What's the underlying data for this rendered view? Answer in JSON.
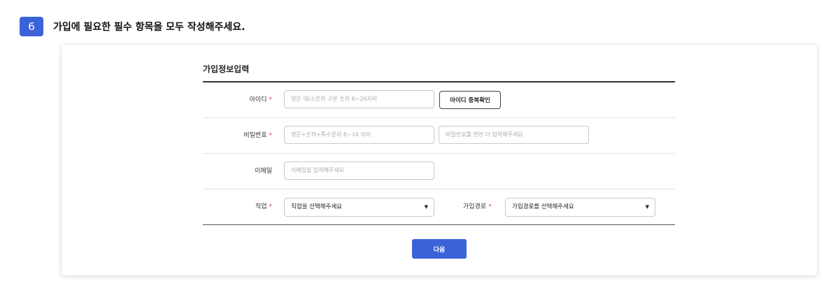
{
  "step": {
    "number": "6",
    "instruction": "가입에 필요한 필수 항목을 모두 작성해주세요."
  },
  "form": {
    "title": "가입정보입력",
    "required_mark": "*",
    "id": {
      "label": "아이디",
      "placeholder": "영문 대/소문자 구분 숫자 6~20자리",
      "check_button": "아이디 중복확인"
    },
    "password": {
      "label": "비밀번호",
      "placeholder": "영문+숫자+특수문자 8~16 자리",
      "confirm_placeholder": "비밀번호를 한번 더 입력해주세요"
    },
    "email": {
      "label": "이메일",
      "placeholder": "이메일을 입력해주세요"
    },
    "job": {
      "label": "직업",
      "selected": "직업을 선택해주세요"
    },
    "referral": {
      "label": "가입경로",
      "selected": "가입경로를 선택해주세요"
    },
    "next_button": "다음"
  },
  "colors": {
    "accent": "#3b63d9",
    "required": "#e04444"
  }
}
